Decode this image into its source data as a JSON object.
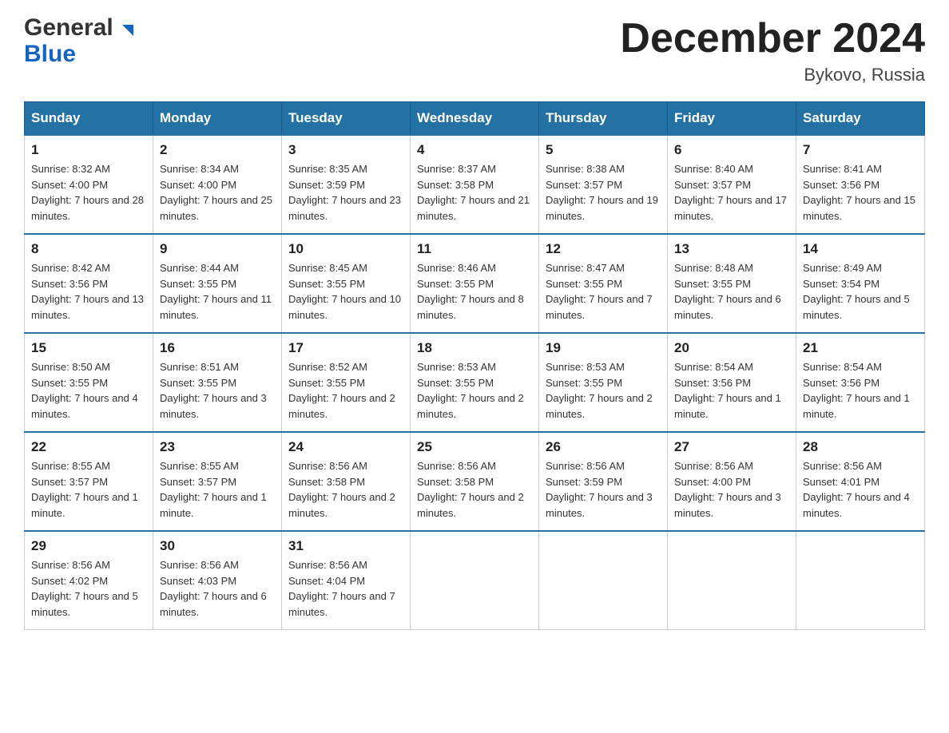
{
  "header": {
    "logo_general": "General",
    "logo_blue": "Blue",
    "month_title": "December 2024",
    "location": "Bykovo, Russia"
  },
  "days_of_week": [
    "Sunday",
    "Monday",
    "Tuesday",
    "Wednesday",
    "Thursday",
    "Friday",
    "Saturday"
  ],
  "weeks": [
    [
      {
        "day": "1",
        "sunrise": "8:32 AM",
        "sunset": "4:00 PM",
        "daylight": "7 hours and 28 minutes."
      },
      {
        "day": "2",
        "sunrise": "8:34 AM",
        "sunset": "4:00 PM",
        "daylight": "7 hours and 25 minutes."
      },
      {
        "day": "3",
        "sunrise": "8:35 AM",
        "sunset": "3:59 PM",
        "daylight": "7 hours and 23 minutes."
      },
      {
        "day": "4",
        "sunrise": "8:37 AM",
        "sunset": "3:58 PM",
        "daylight": "7 hours and 21 minutes."
      },
      {
        "day": "5",
        "sunrise": "8:38 AM",
        "sunset": "3:57 PM",
        "daylight": "7 hours and 19 minutes."
      },
      {
        "day": "6",
        "sunrise": "8:40 AM",
        "sunset": "3:57 PM",
        "daylight": "7 hours and 17 minutes."
      },
      {
        "day": "7",
        "sunrise": "8:41 AM",
        "sunset": "3:56 PM",
        "daylight": "7 hours and 15 minutes."
      }
    ],
    [
      {
        "day": "8",
        "sunrise": "8:42 AM",
        "sunset": "3:56 PM",
        "daylight": "7 hours and 13 minutes."
      },
      {
        "day": "9",
        "sunrise": "8:44 AM",
        "sunset": "3:55 PM",
        "daylight": "7 hours and 11 minutes."
      },
      {
        "day": "10",
        "sunrise": "8:45 AM",
        "sunset": "3:55 PM",
        "daylight": "7 hours and 10 minutes."
      },
      {
        "day": "11",
        "sunrise": "8:46 AM",
        "sunset": "3:55 PM",
        "daylight": "7 hours and 8 minutes."
      },
      {
        "day": "12",
        "sunrise": "8:47 AM",
        "sunset": "3:55 PM",
        "daylight": "7 hours and 7 minutes."
      },
      {
        "day": "13",
        "sunrise": "8:48 AM",
        "sunset": "3:55 PM",
        "daylight": "7 hours and 6 minutes."
      },
      {
        "day": "14",
        "sunrise": "8:49 AM",
        "sunset": "3:54 PM",
        "daylight": "7 hours and 5 minutes."
      }
    ],
    [
      {
        "day": "15",
        "sunrise": "8:50 AM",
        "sunset": "3:55 PM",
        "daylight": "7 hours and 4 minutes."
      },
      {
        "day": "16",
        "sunrise": "8:51 AM",
        "sunset": "3:55 PM",
        "daylight": "7 hours and 3 minutes."
      },
      {
        "day": "17",
        "sunrise": "8:52 AM",
        "sunset": "3:55 PM",
        "daylight": "7 hours and 2 minutes."
      },
      {
        "day": "18",
        "sunrise": "8:53 AM",
        "sunset": "3:55 PM",
        "daylight": "7 hours and 2 minutes."
      },
      {
        "day": "19",
        "sunrise": "8:53 AM",
        "sunset": "3:55 PM",
        "daylight": "7 hours and 2 minutes."
      },
      {
        "day": "20",
        "sunrise": "8:54 AM",
        "sunset": "3:56 PM",
        "daylight": "7 hours and 1 minute."
      },
      {
        "day": "21",
        "sunrise": "8:54 AM",
        "sunset": "3:56 PM",
        "daylight": "7 hours and 1 minute."
      }
    ],
    [
      {
        "day": "22",
        "sunrise": "8:55 AM",
        "sunset": "3:57 PM",
        "daylight": "7 hours and 1 minute."
      },
      {
        "day": "23",
        "sunrise": "8:55 AM",
        "sunset": "3:57 PM",
        "daylight": "7 hours and 1 minute."
      },
      {
        "day": "24",
        "sunrise": "8:56 AM",
        "sunset": "3:58 PM",
        "daylight": "7 hours and 2 minutes."
      },
      {
        "day": "25",
        "sunrise": "8:56 AM",
        "sunset": "3:58 PM",
        "daylight": "7 hours and 2 minutes."
      },
      {
        "day": "26",
        "sunrise": "8:56 AM",
        "sunset": "3:59 PM",
        "daylight": "7 hours and 3 minutes."
      },
      {
        "day": "27",
        "sunrise": "8:56 AM",
        "sunset": "4:00 PM",
        "daylight": "7 hours and 3 minutes."
      },
      {
        "day": "28",
        "sunrise": "8:56 AM",
        "sunset": "4:01 PM",
        "daylight": "7 hours and 4 minutes."
      }
    ],
    [
      {
        "day": "29",
        "sunrise": "8:56 AM",
        "sunset": "4:02 PM",
        "daylight": "7 hours and 5 minutes."
      },
      {
        "day": "30",
        "sunrise": "8:56 AM",
        "sunset": "4:03 PM",
        "daylight": "7 hours and 6 minutes."
      },
      {
        "day": "31",
        "sunrise": "8:56 AM",
        "sunset": "4:04 PM",
        "daylight": "7 hours and 7 minutes."
      },
      null,
      null,
      null,
      null
    ]
  ]
}
